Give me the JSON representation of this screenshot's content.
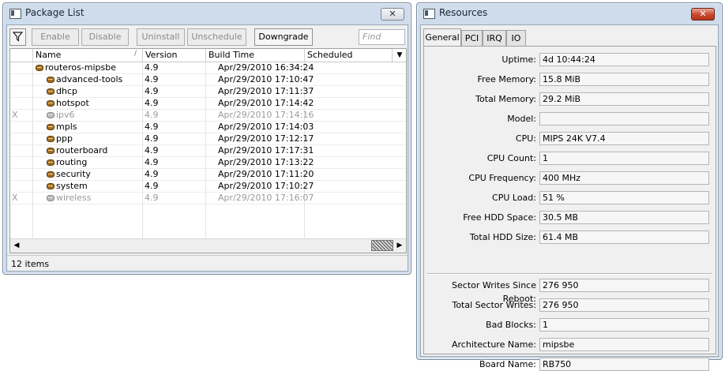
{
  "package_window": {
    "title": "Package List",
    "close_label": "✕",
    "filter_icon": "funnel-icon",
    "toolbar": {
      "enable": "Enable",
      "disable": "Disable",
      "uninstall": "Uninstall",
      "unschedule": "Unschedule",
      "downgrade": "Downgrade",
      "find_placeholder": "Find"
    },
    "columns": [
      "Name",
      "Version",
      "Build Time",
      "Scheduled"
    ],
    "sort_indicator": "/",
    "column_menu": "▼",
    "rows": [
      {
        "flag": "",
        "name": "routeros-mipsbe",
        "version": "4.9",
        "build_time": "Apr/29/2010 16:34:24",
        "scheduled": "",
        "disabled": false,
        "indent": 0
      },
      {
        "flag": "",
        "name": "advanced-tools",
        "version": "4.9",
        "build_time": "Apr/29/2010 17:10:47",
        "scheduled": "",
        "disabled": false,
        "indent": 1
      },
      {
        "flag": "",
        "name": "dhcp",
        "version": "4.9",
        "build_time": "Apr/29/2010 17:11:37",
        "scheduled": "",
        "disabled": false,
        "indent": 1
      },
      {
        "flag": "",
        "name": "hotspot",
        "version": "4.9",
        "build_time": "Apr/29/2010 17:14:42",
        "scheduled": "",
        "disabled": false,
        "indent": 1
      },
      {
        "flag": "X",
        "name": "ipv6",
        "version": "4.9",
        "build_time": "Apr/29/2010 17:14:16",
        "scheduled": "",
        "disabled": true,
        "indent": 1
      },
      {
        "flag": "",
        "name": "mpls",
        "version": "4.9",
        "build_time": "Apr/29/2010 17:14:03",
        "scheduled": "",
        "disabled": false,
        "indent": 1
      },
      {
        "flag": "",
        "name": "ppp",
        "version": "4.9",
        "build_time": "Apr/29/2010 17:12:17",
        "scheduled": "",
        "disabled": false,
        "indent": 1
      },
      {
        "flag": "",
        "name": "routerboard",
        "version": "4.9",
        "build_time": "Apr/29/2010 17:17:31",
        "scheduled": "",
        "disabled": false,
        "indent": 1
      },
      {
        "flag": "",
        "name": "routing",
        "version": "4.9",
        "build_time": "Apr/29/2010 17:13:22",
        "scheduled": "",
        "disabled": false,
        "indent": 1
      },
      {
        "flag": "",
        "name": "security",
        "version": "4.9",
        "build_time": "Apr/29/2010 17:11:20",
        "scheduled": "",
        "disabled": false,
        "indent": 1
      },
      {
        "flag": "",
        "name": "system",
        "version": "4.9",
        "build_time": "Apr/29/2010 17:10:27",
        "scheduled": "",
        "disabled": false,
        "indent": 1
      },
      {
        "flag": "X",
        "name": "wireless",
        "version": "4.9",
        "build_time": "Apr/29/2010 17:16:07",
        "scheduled": "",
        "disabled": true,
        "indent": 1
      }
    ],
    "scroll_left": "◀",
    "scroll_right": "▶",
    "status": "12 items"
  },
  "resources_window": {
    "title": "Resources",
    "close_label": "✕",
    "tabs": [
      "General",
      "PCI",
      "IRQ",
      "IO"
    ],
    "active_tab": "General",
    "fields": [
      {
        "label": "Uptime:",
        "value": "4d 10:44:24"
      },
      {
        "label": "Free Memory:",
        "value": "15.8 MiB"
      },
      {
        "label": "Total Memory:",
        "value": "29.2 MiB"
      },
      {
        "label": "Model:",
        "value": ""
      },
      {
        "label": "CPU:",
        "value": "MIPS 24K V7.4"
      },
      {
        "label": "CPU Count:",
        "value": "1"
      },
      {
        "label": "CPU Frequency:",
        "value": "400 MHz"
      },
      {
        "label": "CPU Load:",
        "value": "51 %"
      },
      {
        "label": "Free HDD Space:",
        "value": "30.5 MB"
      },
      {
        "label": "Total HDD Size:",
        "value": "61.4 MB"
      }
    ],
    "fields2": [
      {
        "label": "Sector Writes Since Reboot:",
        "value": "276 950"
      },
      {
        "label": "Total Sector Writes:",
        "value": "276 950"
      },
      {
        "label": "Bad Blocks:",
        "value": "1"
      },
      {
        "label": "Architecture Name:",
        "value": "mipsbe"
      },
      {
        "label": "Board Name:",
        "value": "RB750"
      }
    ]
  }
}
